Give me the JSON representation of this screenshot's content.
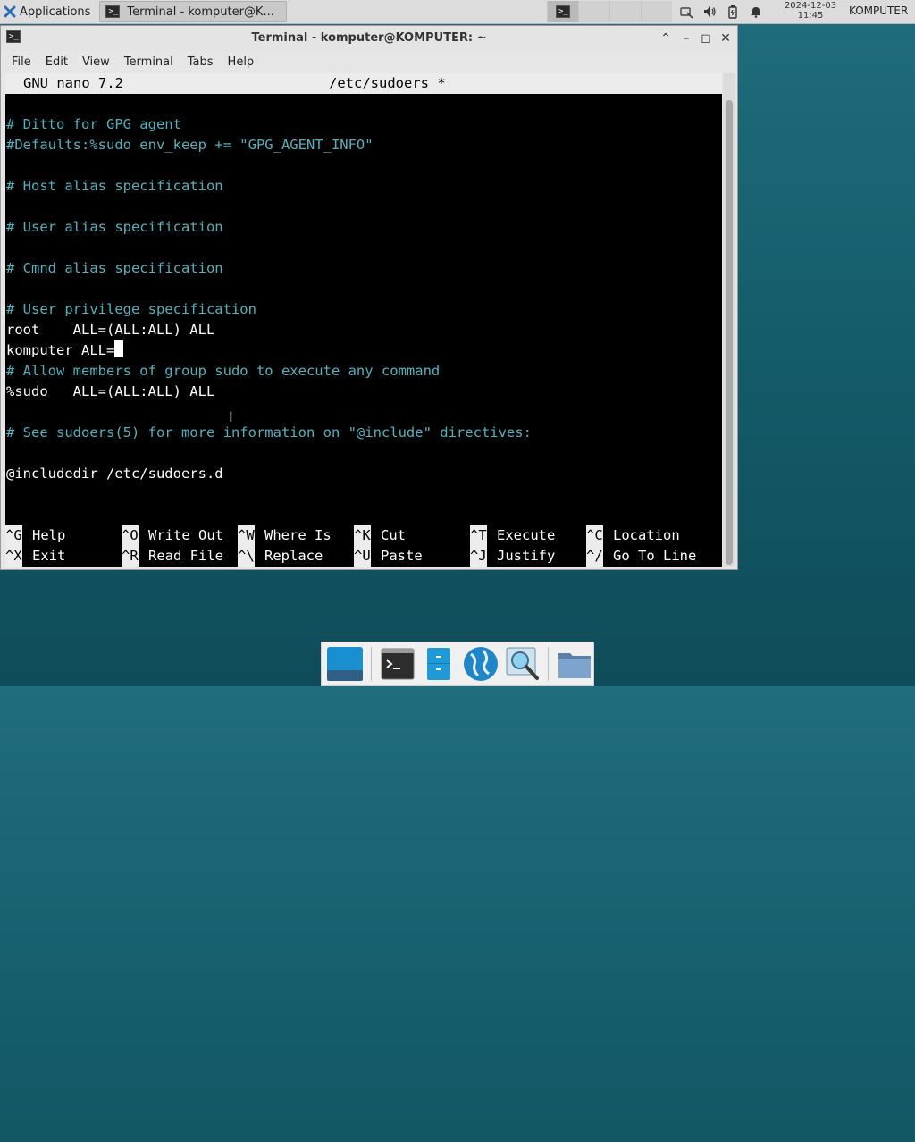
{
  "top_panel": {
    "applications_label": "Applications",
    "task_label": "Terminal - komputer@K...",
    "clock_date": "2024-12-03",
    "clock_time": "11:45",
    "user_label": "KOMPUTER"
  },
  "window": {
    "title": "Terminal - komputer@KOMPUTER: ~",
    "menu": [
      "File",
      "Edit",
      "View",
      "Terminal",
      "Tabs",
      "Help"
    ]
  },
  "nano": {
    "version": "GNU nano 7.2",
    "filename": "/etc/sudoers *",
    "lines": [
      "# Ditto for GPG agent",
      "#Defaults:%sudo env_keep += \"GPG_AGENT_INFO\"",
      "# Host alias specification",
      "# User alias specification",
      "# Cmnd alias specification",
      "# User privilege specification",
      "root    ALL=(ALL:ALL) ALL",
      "komputer ALL=",
      "# Allow members of group sudo to execute any command",
      "%sudo   ALL=(ALL:ALL) ALL",
      "# See sudoers(5) for more information on \"@include\" directives:",
      "@includedir /etc/sudoers.d"
    ],
    "shortcuts_row1": [
      {
        "key": "^G",
        "label": "Help"
      },
      {
        "key": "^O",
        "label": "Write Out"
      },
      {
        "key": "^W",
        "label": "Where Is"
      },
      {
        "key": "^K",
        "label": "Cut"
      },
      {
        "key": "^T",
        "label": "Execute"
      },
      {
        "key": "^C",
        "label": "Location"
      }
    ],
    "shortcuts_row2": [
      {
        "key": "^X",
        "label": "Exit"
      },
      {
        "key": "^R",
        "label": "Read File"
      },
      {
        "key": "^\\",
        "label": "Replace"
      },
      {
        "key": "^U",
        "label": "Paste"
      },
      {
        "key": "^J",
        "label": "Justify"
      },
      {
        "key": "^/",
        "label": "Go To Line"
      }
    ]
  },
  "colors": {
    "comment": "#4fb3bf",
    "terminal_bg": "#000000",
    "desktop_bg": "#1a6472"
  },
  "dock_icons": [
    "show-desktop-icon",
    "terminal-icon",
    "file-manager-icon",
    "web-browser-icon",
    "app-finder-icon",
    "folder-icon"
  ]
}
